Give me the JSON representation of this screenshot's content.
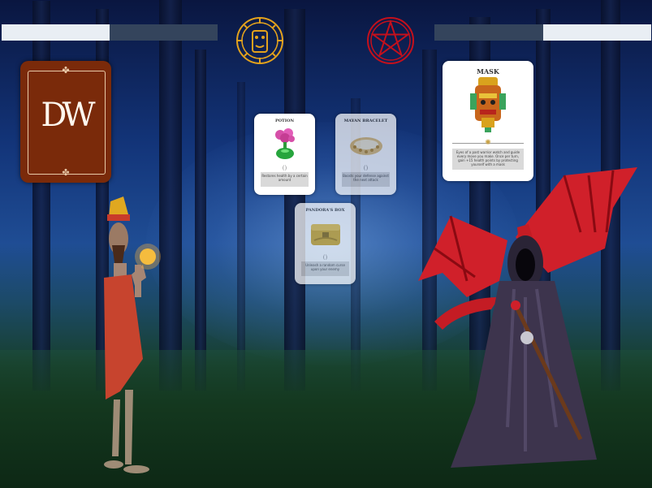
{
  "player": {
    "health": 0.5
  },
  "enemy": {
    "health": 0.5
  },
  "emblems": {
    "player": "sun-mask-emblem",
    "enemy": "pentagram-emblem"
  },
  "deck": {
    "logo": "DW"
  },
  "cards": [
    {
      "id": "potion",
      "title": "POTION",
      "symbol": "()",
      "description": "Restores health by a certain amount"
    },
    {
      "id": "mayan-bracelet",
      "title": "MAYAN BRACELET",
      "symbol": "()",
      "description": "Boosts your defense against the next attack"
    },
    {
      "id": "pandoras-box",
      "title": "PANDORA'S BOX",
      "symbol": "()",
      "description": "Unleash a random curse upon your enemy"
    },
    {
      "id": "mask",
      "title": "MASK",
      "symbol": "",
      "description": "Eyes of a past warrior watch and guide every move you make. Once per turn, gain +15 health points by protecting yourself with a mask"
    }
  ],
  "colors": {
    "sky": "#13357a",
    "deck": "#7a2a0a",
    "sun_emblem": "#e4a21c",
    "pent_emblem": "#c4101c",
    "bar_fill": "#e9eef4",
    "bar_empty": "#34445c"
  }
}
